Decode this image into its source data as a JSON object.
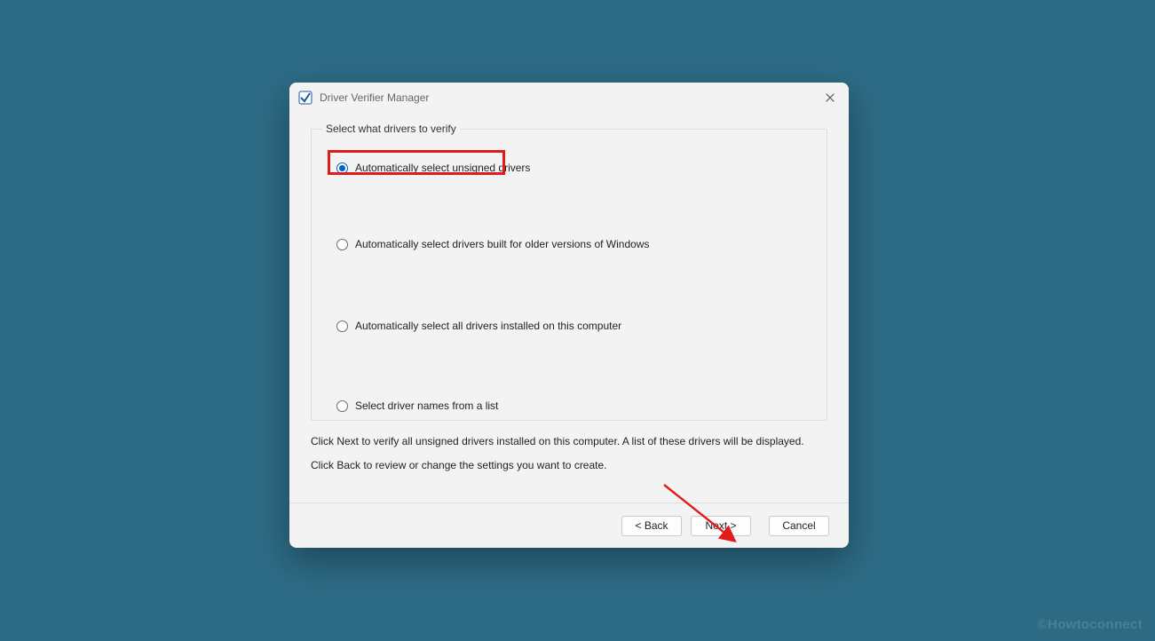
{
  "window": {
    "title": "Driver Verifier Manager",
    "icon": "verifier-app-icon",
    "close_icon": "close-icon"
  },
  "group": {
    "legend": "Select what drivers to verify",
    "options": [
      {
        "label": "Automatically select unsigned drivers",
        "checked": true
      },
      {
        "label": "Automatically select drivers built for older versions of Windows",
        "checked": false
      },
      {
        "label": "Automatically select all drivers installed on this computer",
        "checked": false
      },
      {
        "label": "Select driver names from a list",
        "checked": false
      }
    ]
  },
  "hints": {
    "line1": "Click Next to verify all unsigned drivers installed on this computer. A list of these drivers will be displayed.",
    "line2": "Click Back to review or change the settings you want to create."
  },
  "footer": {
    "back": "< Back",
    "next": "Next >",
    "cancel": "Cancel"
  },
  "watermark": "©Howtoconnect",
  "annotation": {
    "highlight_radio_index": 0,
    "arrow_color": "#e11b1b"
  }
}
